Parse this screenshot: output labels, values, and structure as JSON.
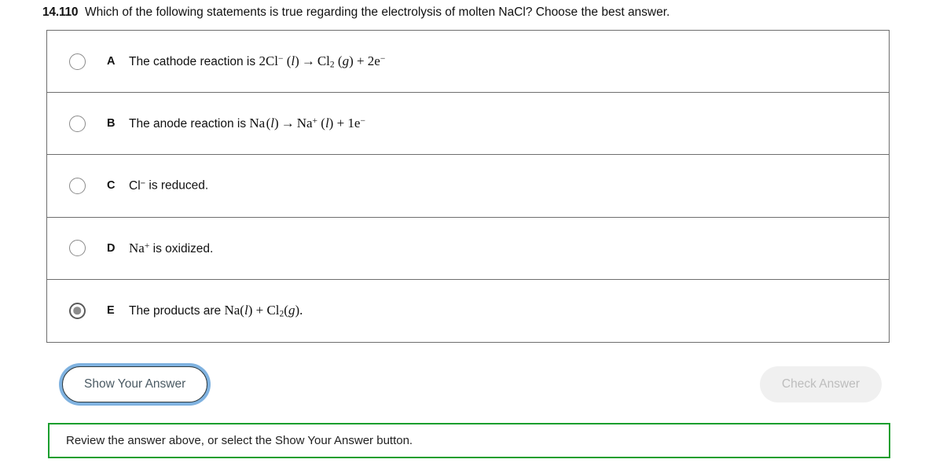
{
  "question": {
    "number": "14.110",
    "prompt": "Which of the following statements is true regarding the electrolysis of molten NaCl?  Choose the best answer."
  },
  "options": [
    {
      "letter": "A",
      "text": "The cathode reaction is 2Cl⁻ (l) → Cl₂ (g) + 2e⁻",
      "selected": false
    },
    {
      "letter": "B",
      "text": "The anode reaction is Na (l) → Na⁺ (l) + 1e⁻",
      "selected": false
    },
    {
      "letter": "C",
      "text": "Cl⁻ is reduced.",
      "selected": false
    },
    {
      "letter": "D",
      "text": "Na⁺ is oxidized.",
      "selected": false
    },
    {
      "letter": "E",
      "text": "The products are Na(l) + Cl₂(g).",
      "selected": true
    }
  ],
  "buttons": {
    "show_answer": "Show Your Answer",
    "check_answer": "Check Answer",
    "check_answer_disabled": true
  },
  "status": {
    "message": "Review the answer above, or select the Show Your Answer button.",
    "border_color": "#1a9e2e"
  },
  "colors": {
    "card_border": "#6e6e6e",
    "focus_ring": "#7fb2e0",
    "show_answer_border": "#2f3a3f",
    "show_answer_text": "#4a5a63",
    "check_answer_bg": "#f0f0f0",
    "check_answer_text": "#bdbdbd",
    "radio_unselected": "#8a8a8a",
    "radio_selected_ring": "#595959",
    "radio_selected_dot": "#8c8c8c"
  }
}
